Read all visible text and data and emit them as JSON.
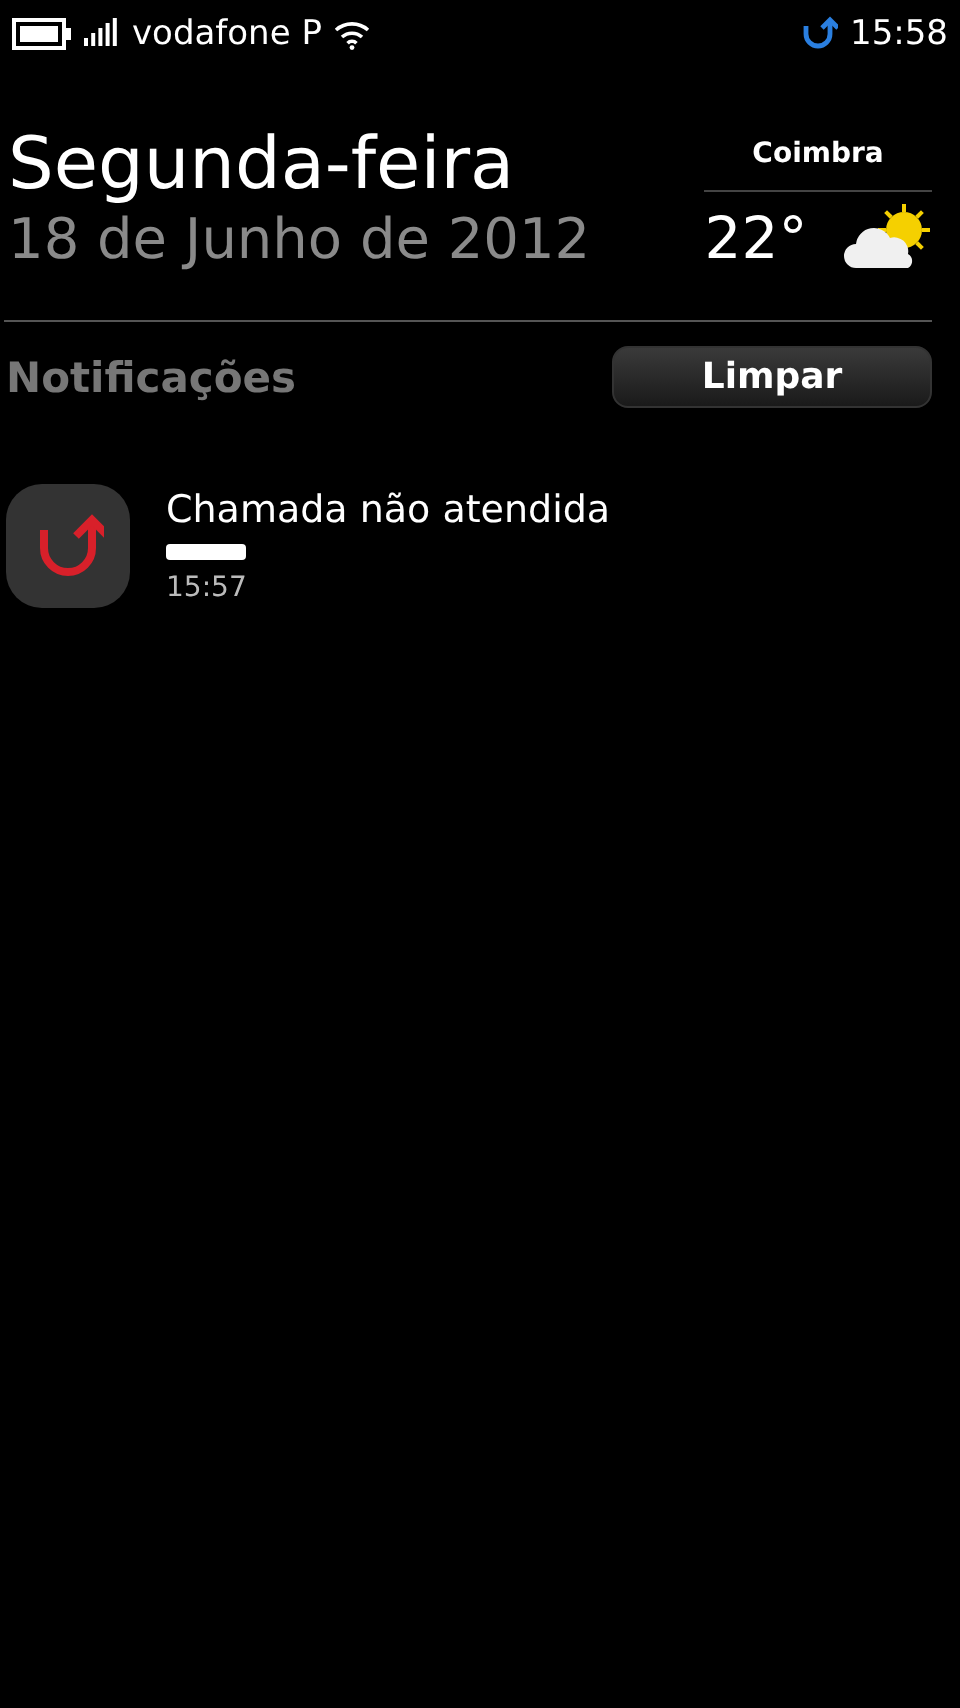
{
  "status_bar": {
    "carrier": "vodafone P",
    "time": "15:58"
  },
  "header": {
    "day": "Segunda-feira",
    "date": "18 de Junho de 2012"
  },
  "weather": {
    "city": "Coimbra",
    "temperature": "22°"
  },
  "notifications": {
    "title": "Notificações",
    "clear_button": "Limpar",
    "items": [
      {
        "kind": "missed-call",
        "title": "Chamada não atendida",
        "time": "15:57"
      }
    ]
  }
}
